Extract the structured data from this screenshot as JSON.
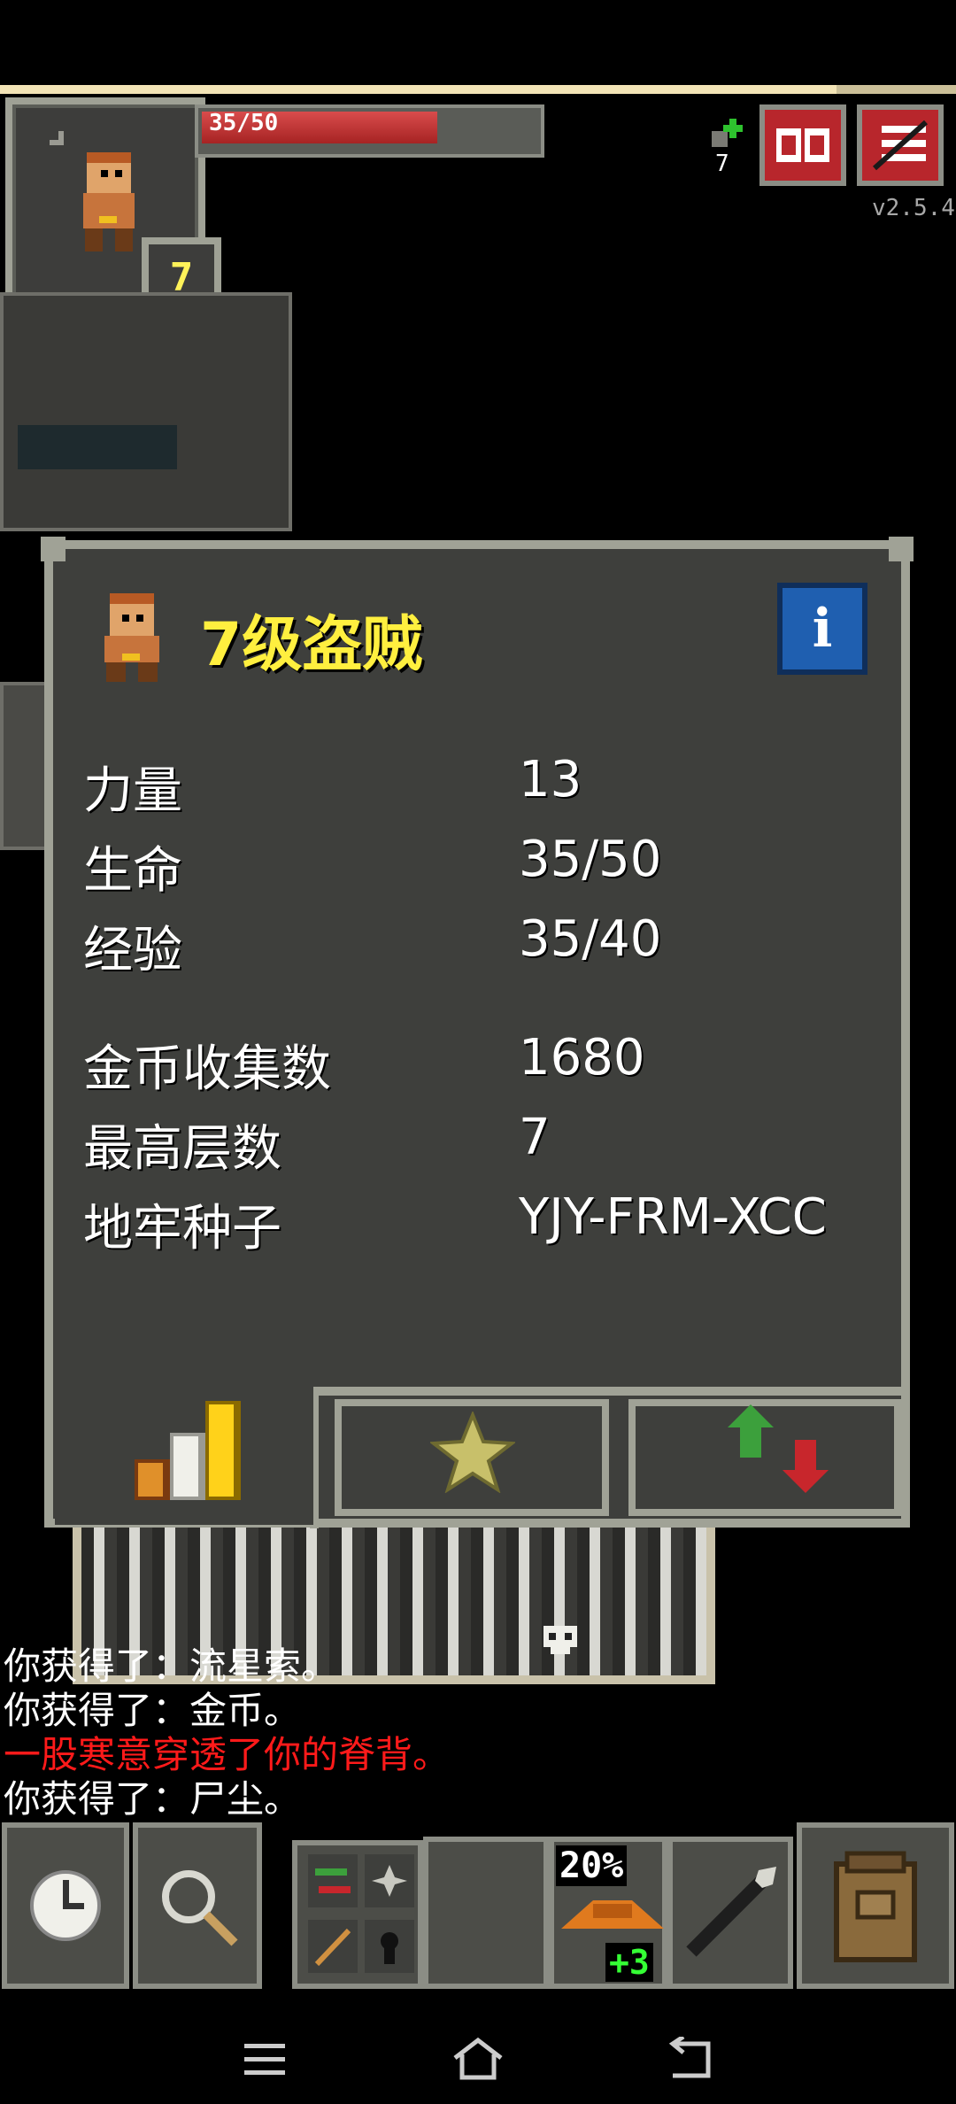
{
  "hud": {
    "hp_text": "35/50",
    "hp_fraction": 0.7,
    "xp_fraction": 0.875,
    "level": "7",
    "key_count": "7",
    "version": "v2.5.4"
  },
  "dialog": {
    "title": "7级盗贼",
    "info_icon": "i",
    "stats": [
      {
        "label": "力量",
        "value": "13"
      },
      {
        "label": "生命",
        "value": "35/50"
      },
      {
        "label": "经验",
        "value": "35/40"
      },
      {
        "label": "金币收集数",
        "value": "1680"
      },
      {
        "label": "最高层数",
        "value": "7"
      },
      {
        "label": "地牢种子",
        "value": "YJY-FRM-XCC"
      }
    ],
    "tabs": [
      "stats-chart-icon",
      "star-icon",
      "up-down-arrows-icon"
    ]
  },
  "log": {
    "lines": [
      {
        "text": "你获得了：流星索。",
        "color": "#ffffff"
      },
      {
        "text": "你获得了：金币。",
        "color": "#ffffff"
      },
      {
        "text": "一股寒意穿透了你的脊背。",
        "color": "#ff1a1a"
      },
      {
        "text": "你获得了：尸尘。",
        "color": "#ffffff"
      }
    ]
  },
  "toolbar": {
    "quickslot_percent": "20%",
    "quickslot_bonus": "+3"
  },
  "colors": {
    "accent_red": "#b8262c",
    "title_yellow": "#ffef3f",
    "info_blue": "#1f5fb0",
    "panel": "#3e3f3c",
    "border": "#a0a296"
  }
}
